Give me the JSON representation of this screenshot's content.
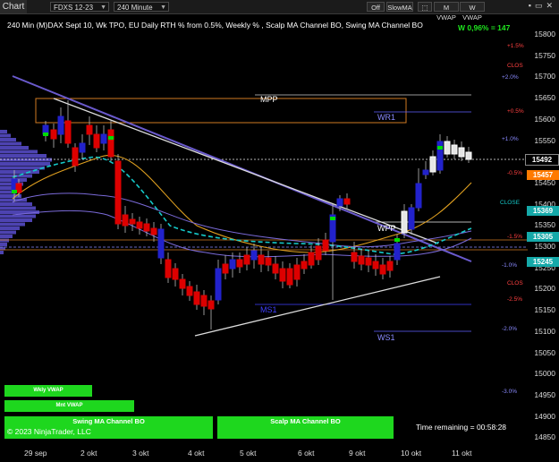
{
  "toolbar": {
    "chart_tab": "Chart",
    "instrument": "FDXS 12-23",
    "interval": "240 Minute",
    "off_label": "Off",
    "slowma_label": "SlowMA",
    "mvwap_label": "M VWAP",
    "wvwap_label": "W VWAP"
  },
  "header": {
    "title": "240 Min (M)DAX Sept 10, Wk TPO, EU Daily RTH % from 0.5%, Weekly % , Scalp MA Channel BO, Swing MA Channel BO",
    "performance": "W 0,96% = 147"
  },
  "price_axis": {
    "ticks": [
      "15800",
      "15750",
      "15700",
      "15650",
      "15600",
      "15550",
      "15500",
      "15450",
      "15400",
      "15350",
      "15300",
      "15250",
      "15200",
      "15150",
      "15100",
      "15050",
      "15000",
      "14950",
      "14900",
      "14850"
    ],
    "current_price": "15492",
    "boxes": [
      {
        "value": "15457",
        "color": "#ff7a00"
      },
      {
        "value": "15369",
        "color": "#15a9a9"
      },
      {
        "value": "15305",
        "color": "#15a9a9"
      },
      {
        "value": "15245",
        "color": "#15a9a9"
      }
    ]
  },
  "levels": {
    "mpp": "MPP",
    "wr1": "WR1",
    "wpp": "WPP",
    "ms1": "MS1",
    "ws1": "WS1"
  },
  "pct_labels": [
    "+1.5%",
    "+2.0%",
    "+0.5%",
    "+1.0%",
    "-0.5%",
    "CLOSE",
    "-1.5%",
    "-1.0%",
    "-2.5%",
    "-2.0%",
    "-3.0%",
    "CLOS",
    "CLOS"
  ],
  "x_axis": {
    "dates": [
      "29 sep",
      "2 okt",
      "3 okt",
      "4 okt",
      "5 okt",
      "6 okt",
      "9 okt",
      "10 okt",
      "11 okt"
    ]
  },
  "bottom": {
    "wkly_vwap": "Wkly VWAP",
    "mnt_vwap": "Mnt VWAP",
    "swing_channel": "Swing MA Channel BO",
    "scalp_channel": "Scalp MA Channel BO",
    "copyright": "© 2023 NinjaTrader, LLC",
    "time_remaining": "Time remaining = 00:58:28"
  },
  "colors": {
    "up_candle": "#2222cc",
    "down_candle": "#dd0000",
    "bo_marker": "#00dd00",
    "vwap_green": "#1ed71e",
    "cyan_ma": "#15c8c8",
    "pivot_orange": "#d07a22",
    "pivot_blue": "#6060ff"
  }
}
